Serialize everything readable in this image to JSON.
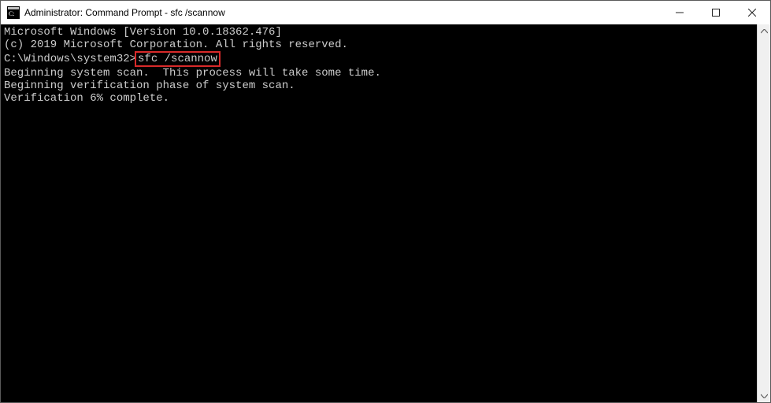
{
  "window": {
    "title": "Administrator: Command Prompt - sfc  /scannow"
  },
  "winControls": {
    "minimize": "minimize",
    "maximize": "maximize",
    "close": "close"
  },
  "terminal": {
    "line1": "Microsoft Windows [Version 10.0.18362.476]",
    "line2": "(c) 2019 Microsoft Corporation. All rights reserved.",
    "blank1": "",
    "promptPrefix": "C:\\Windows\\system32>",
    "command": "sfc /scannow",
    "blank2": "",
    "line5": "Beginning system scan.  This process will take some time.",
    "blank3": "",
    "line7": "Beginning verification phase of system scan.",
    "line8": "Verification 6% complete."
  },
  "scrollbar": {
    "up": "scroll-up",
    "down": "scroll-down"
  }
}
